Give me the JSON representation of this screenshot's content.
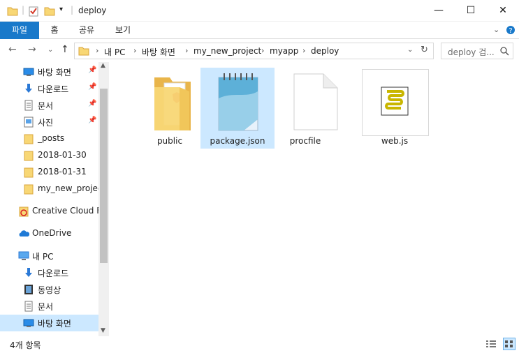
{
  "window": {
    "title": "deploy",
    "minimize": "—",
    "maximize": "☐",
    "close": "✕"
  },
  "ribbon": {
    "tabs": [
      "파일",
      "홈",
      "공유",
      "보기"
    ]
  },
  "address": {
    "crumbs": [
      "내 PC",
      "바탕 화면",
      "my_new_project",
      "myapp",
      "deploy"
    ],
    "search_placeholder": "deploy 검..."
  },
  "sidebar": {
    "items": [
      {
        "label": "바탕 화면",
        "icon": "desktop-icon",
        "pinned": true
      },
      {
        "label": "다운로드",
        "icon": "download-arrow-icon",
        "pinned": true
      },
      {
        "label": "문서",
        "icon": "document-icon",
        "pinned": true
      },
      {
        "label": "사진",
        "icon": "pictures-icon",
        "pinned": true
      },
      {
        "label": "_posts",
        "icon": "folder-icon",
        "pinned": false
      },
      {
        "label": "2018-01-30",
        "icon": "folder-icon",
        "pinned": false
      },
      {
        "label": "2018-01-31",
        "icon": "folder-icon",
        "pinned": false
      },
      {
        "label": "my_new_project",
        "icon": "folder-icon",
        "pinned": false
      },
      {
        "label": "Creative Cloud Fil",
        "icon": "creative-cloud-icon",
        "pinned": false
      },
      {
        "label": "OneDrive",
        "icon": "onedrive-cloud-icon",
        "pinned": false
      },
      {
        "label": "내 PC",
        "icon": "pc-icon",
        "pinned": false
      },
      {
        "label": "다운로드",
        "icon": "download-arrow-icon",
        "pinned": false
      },
      {
        "label": "동영상",
        "icon": "video-icon",
        "pinned": false
      },
      {
        "label": "문서",
        "icon": "document-icon",
        "pinned": false
      },
      {
        "label": "바탕 화면",
        "icon": "desktop-icon",
        "pinned": false,
        "selected": true
      }
    ]
  },
  "files": [
    {
      "name": "public",
      "icon": "folder-icon"
    },
    {
      "name": "package.json",
      "icon": "notepad-icon",
      "selected": true
    },
    {
      "name": "procfile",
      "icon": "blank-file-icon"
    },
    {
      "name": "web.js",
      "icon": "script-file-icon"
    }
  ],
  "status": {
    "count": "4개 항목"
  },
  "colors": {
    "accent": "#1979ca",
    "selection": "#cce8ff",
    "folder": "#f8d775"
  }
}
